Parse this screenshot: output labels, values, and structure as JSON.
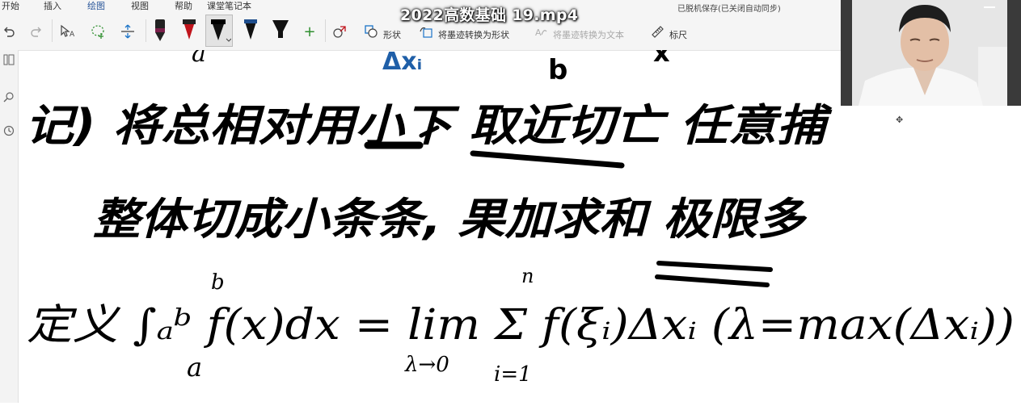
{
  "ribbon": {
    "tabs": [
      {
        "label": "开始"
      },
      {
        "label": "插入"
      },
      {
        "label": "绘图",
        "active": true
      },
      {
        "label": "视图"
      },
      {
        "label": "帮助"
      },
      {
        "label": "课堂笔记本"
      }
    ],
    "sync_status": "已脱机保存(已关闭自动同步)"
  },
  "video": {
    "title": "2022高数基础 19.mp4"
  },
  "toolbar": {
    "shapes_label": "形状",
    "ink_to_shape_label": "将墨迹转换为形状",
    "ink_to_text_label": "将墨迹转换为文本",
    "ruler_label": "标尺",
    "pen_colors": [
      "#7a1f4a",
      "#c0141c",
      "#111111",
      "#1e4d8c",
      "#111111"
    ],
    "add_pen_symbol": "+"
  },
  "note": {
    "line1": "记) 将总相对用小下 取近切亡 任意捕",
    "line2": "整体切成小条条, 果加求和 极限多",
    "line3": "定义 ∫ₐᵇ f(x)dx = lim Σ f(ξᵢ)Δxᵢ  (λ=max(Δxᵢ))",
    "top_fragments": [
      "a",
      "Δxᵢ",
      "b",
      "x"
    ],
    "integral_lower": "a",
    "integral_upper": "b",
    "limit_sub": "λ→0",
    "sum_upper": "n",
    "sum_lower": "i=1"
  }
}
